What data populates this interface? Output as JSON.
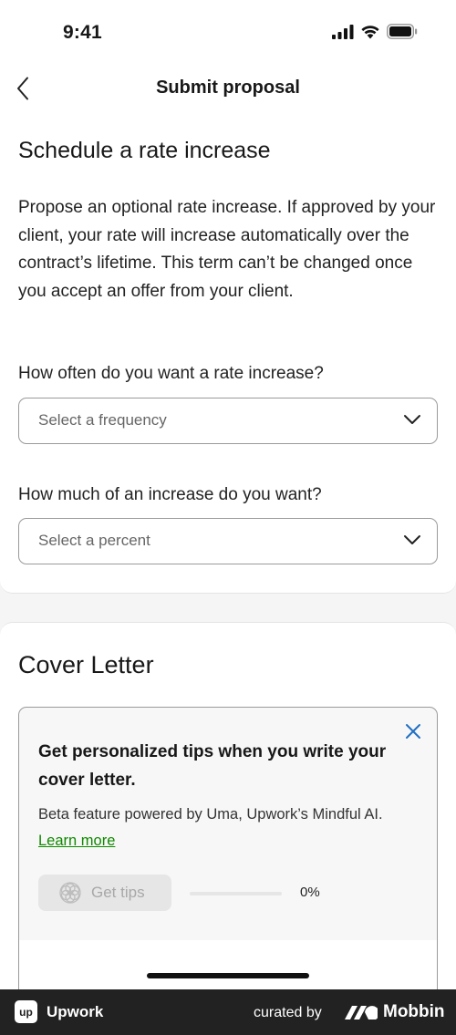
{
  "status_bar": {
    "time": "9:41"
  },
  "nav": {
    "title": "Submit proposal"
  },
  "rate_section": {
    "title": "Schedule a rate increase",
    "description": "Propose an optional rate increase. If approved by your client, your rate will increase automatically over the contract’s lifetime. This term can’t be changed once you accept an offer from your client.",
    "frequency_label": "How often do you want a rate increase?",
    "frequency_placeholder": "Select a frequency",
    "percent_label": "How much of an increase do you want?",
    "percent_placeholder": "Select a percent"
  },
  "cover_letter": {
    "title": "Cover Letter",
    "tips": {
      "title": "Get personalized tips when you write your cover letter.",
      "description": "Beta feature powered by Uma, Upwork’s Mindful AI.",
      "learn_more": "Learn more",
      "button_label": "Get tips",
      "progress_percent": 0,
      "progress_text": "0%"
    }
  },
  "footer": {
    "brand": "Upwork",
    "brand_logo_text": "up",
    "curated_by": "curated by",
    "mobbin": "Mobbin"
  },
  "colors": {
    "link_green": "#108a00",
    "footer_bg": "#222222"
  },
  "icons": {
    "back": "chevron-left-icon",
    "select_chevron": "chevron-down-icon",
    "close": "close-icon",
    "tips": "uma-logo-icon"
  }
}
